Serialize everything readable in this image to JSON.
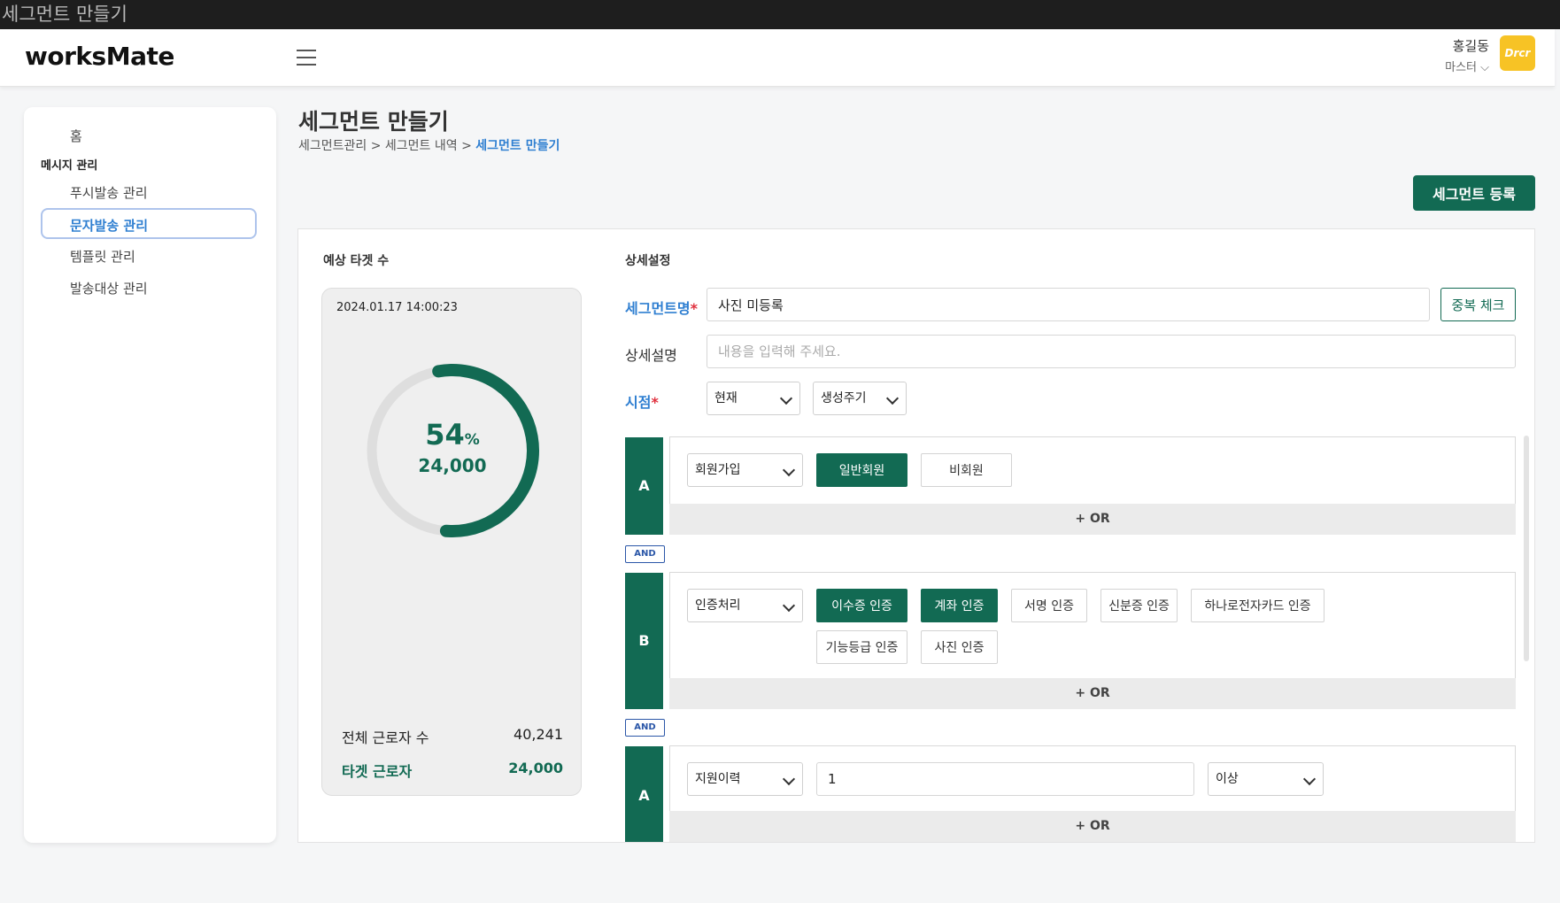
{
  "window": {
    "title": "세그먼트 만들기"
  },
  "header": {
    "logo_prefix": "worksM",
    "logo_m": "",
    "logo_suffix": "ate",
    "user_name": "홍길동",
    "user_role": "마스터 ⌵",
    "avatar_text": "Drcr"
  },
  "sidebar": {
    "home": "홈",
    "group_label": "메시지 관리",
    "items": [
      {
        "label": "푸시발송 관리"
      },
      {
        "label": "문자발송 관리"
      },
      {
        "label": "템플릿 관리"
      },
      {
        "label": "발송대상 관리"
      }
    ]
  },
  "page": {
    "title": "세그먼트 만들기",
    "breadcrumb": [
      "세그먼트관리",
      "세그먼트 내역",
      "세그먼트 만들기"
    ],
    "breadcrumb_separator": ">",
    "register_button": "세그먼트 등록"
  },
  "target": {
    "section_label": "예상 타겟 수",
    "timestamp": "2024.01.17 14:00:23",
    "percent_value": "54",
    "percent_unit": "%",
    "percent_fraction": 0.54,
    "count": "24,000",
    "total_label": "전체 근로자 수",
    "total_value": "40,241",
    "target_label": "타겟 근로자",
    "target_value": "24,000"
  },
  "detail": {
    "section_label": "상세설정",
    "segment_name_label": "세그먼트명",
    "segment_name_value": "사진 미등록",
    "dup_check_button": "중복 체크",
    "description_label": "상세설명",
    "description_placeholder": "내용을 입력해 주세요.",
    "timepoint_label": "시점",
    "timepoint_select": "현재",
    "cycle_select": "생성주기"
  },
  "conditions": [
    {
      "tag": "A",
      "select": "회원가입",
      "chips": [
        {
          "label": "일반회원",
          "selected": true
        },
        {
          "label": "비회원",
          "selected": false
        }
      ],
      "or_label": "+ OR"
    },
    {
      "tag": "B",
      "select": "인증처리",
      "chips": [
        {
          "label": "이수증 인증",
          "selected": true
        },
        {
          "label": "계좌 인증",
          "selected": true
        },
        {
          "label": "서명 인증",
          "selected": false
        },
        {
          "label": "신분증 인증",
          "selected": false
        },
        {
          "label": "하나로전자카드 인증",
          "selected": false
        },
        {
          "label": "기능등급 인증",
          "selected": false
        },
        {
          "label": "사진 인증",
          "selected": false
        }
      ],
      "or_label": "+ OR"
    },
    {
      "tag": "A",
      "select": "지원이력",
      "input_value": "1",
      "operator_select": "이상",
      "or_label": "+ OR"
    }
  ],
  "and_label": "AND",
  "colors": {
    "primary": "#126a53",
    "link": "#2f7fd1",
    "required": "#e0303d",
    "avatar": "#f7c325"
  }
}
